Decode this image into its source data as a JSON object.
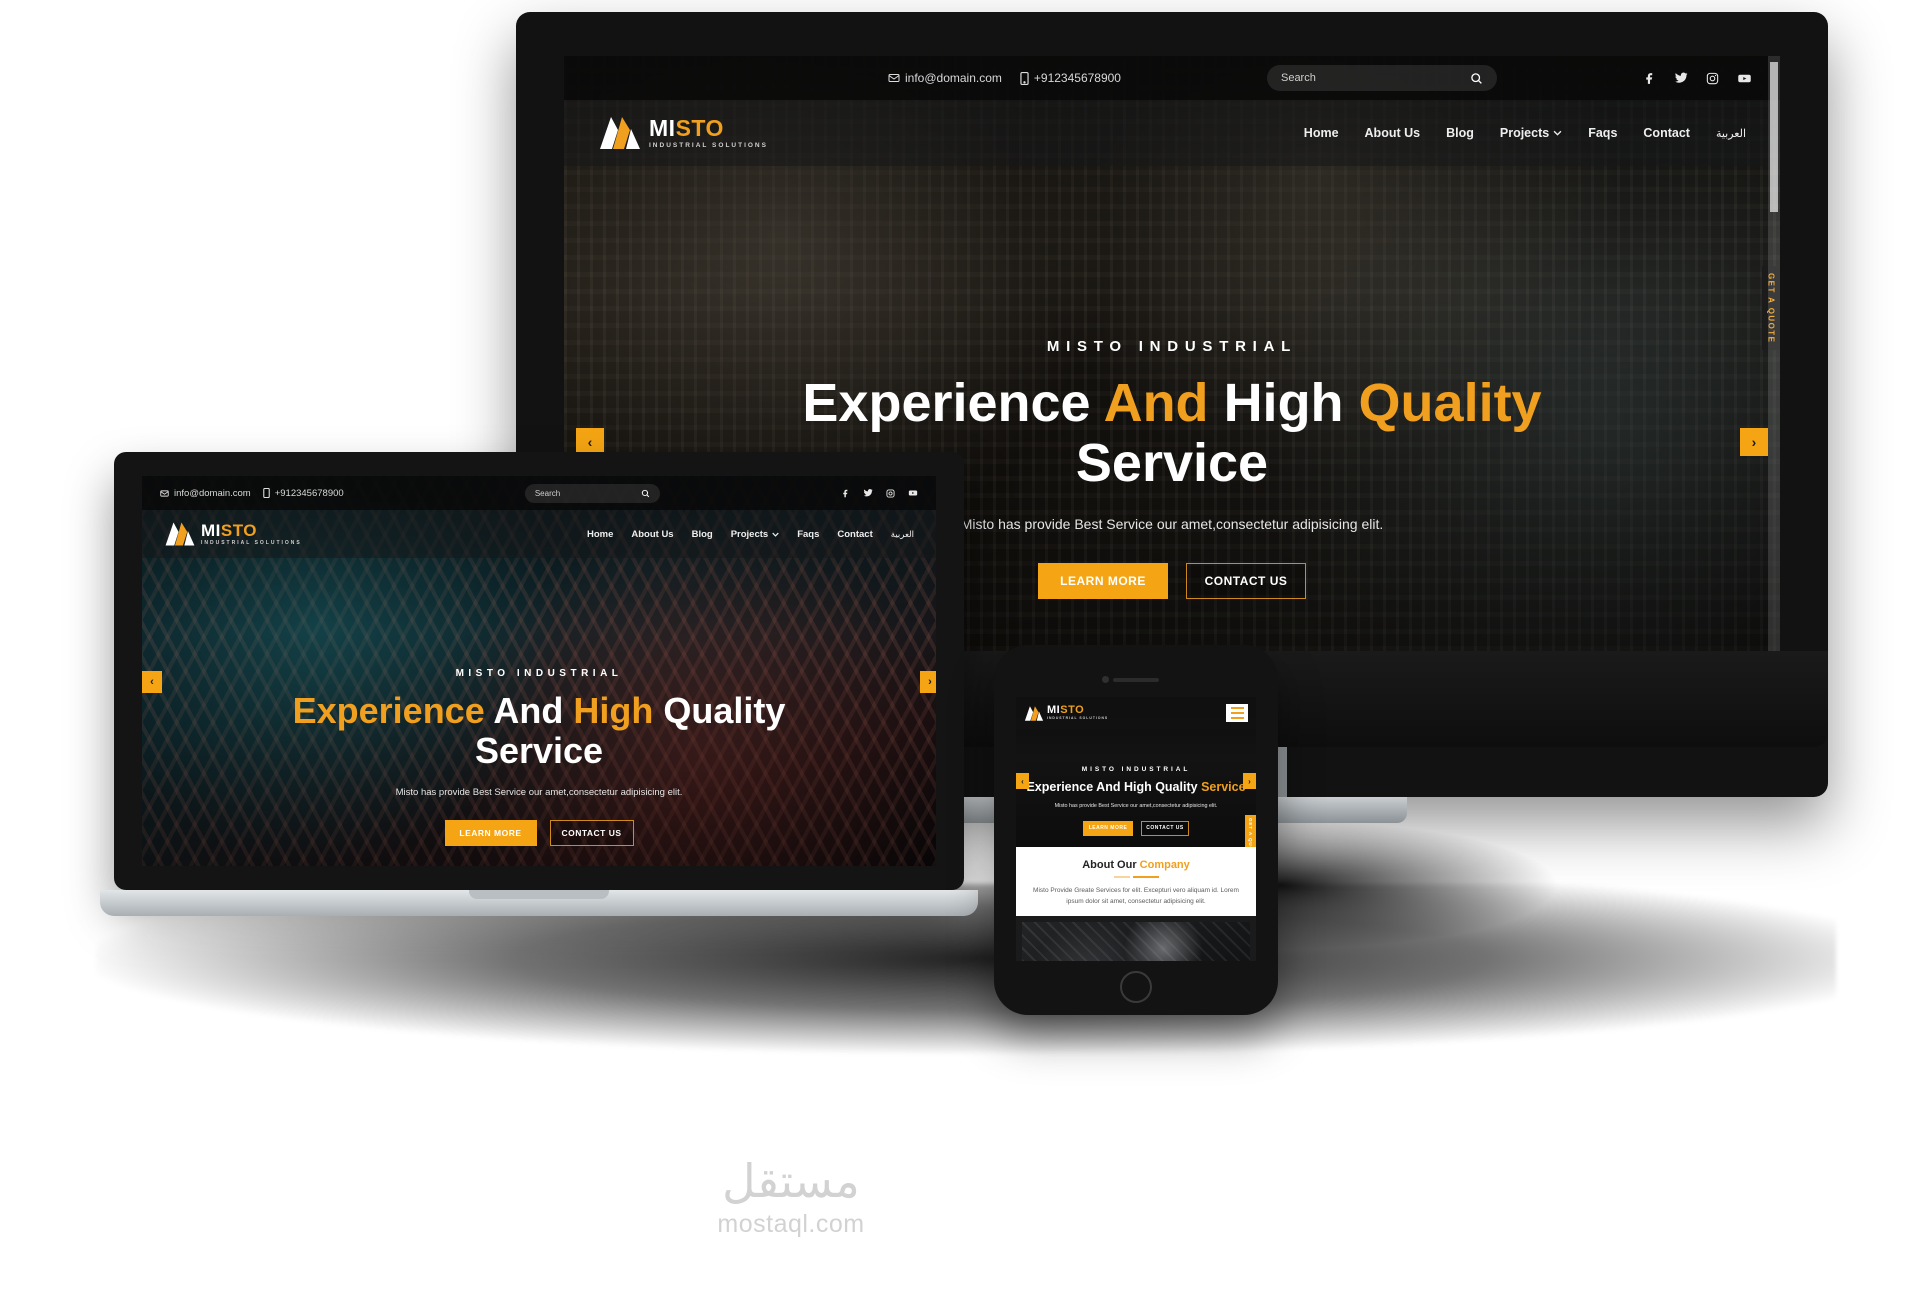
{
  "brand": {
    "name_part1": "MI",
    "name_s": "S",
    "name_to": "TO",
    "tagline": "INDUSTRIAL SOLUTIONS",
    "accent_color": "#f0a01e",
    "button_color": "#f5a513"
  },
  "topbar": {
    "email": "info@domain.com",
    "phone": "+912345678900",
    "email_icon": "envelope-icon",
    "phone_icon": "mobile-phone-icon",
    "search_placeholder": "Search",
    "search_icon": "search-icon",
    "social": [
      {
        "name": "facebook-icon",
        "label": "f"
      },
      {
        "name": "twitter-icon",
        "label": "t"
      },
      {
        "name": "instagram-icon",
        "label": "ig"
      },
      {
        "name": "youtube-icon",
        "label": "yt"
      }
    ]
  },
  "nav": {
    "items": [
      {
        "label": "Home",
        "has_dropdown": false
      },
      {
        "label": "About Us",
        "has_dropdown": false
      },
      {
        "label": "Blog",
        "has_dropdown": false
      },
      {
        "label": "Projects",
        "has_dropdown": true
      },
      {
        "label": "Faqs",
        "has_dropdown": false
      },
      {
        "label": "Contact",
        "has_dropdown": false
      },
      {
        "label": "العربية",
        "has_dropdown": false
      }
    ],
    "dropdown_icon": "chevron-down-icon",
    "hamburger_icon": "hamburger-menu-icon"
  },
  "hero": {
    "eyebrow": "MISTO INDUSTRIAL",
    "title_line1_a": "Experience ",
    "title_line1_b": "And ",
    "title_line1_c": "High ",
    "title_line1_d": "Quality",
    "title_line2": "Service",
    "paragraph": "Misto has provide Best Service our amet,consectetur adipisicing elit.",
    "btn_primary": "LEARN MORE",
    "btn_secondary": "CONTACT US",
    "prev_icon": "chevron-left-icon",
    "next_icon": "chevron-right-icon",
    "quote_tab": "GET A QUOTE"
  },
  "mobile_about": {
    "title_a": "About Our ",
    "title_b": "Company",
    "paragraph": "Misto Provide Greate Services for elit. Excepturi vero aliquam id. Lorem ipsum dolor sit amet, consectetur adipisicing elit."
  },
  "watermark": {
    "arabic": "مستقل",
    "latin": "mostaql.com"
  },
  "devices": {
    "monitor": "desktop-monitor",
    "laptop": "laptop",
    "phone": "smartphone"
  }
}
